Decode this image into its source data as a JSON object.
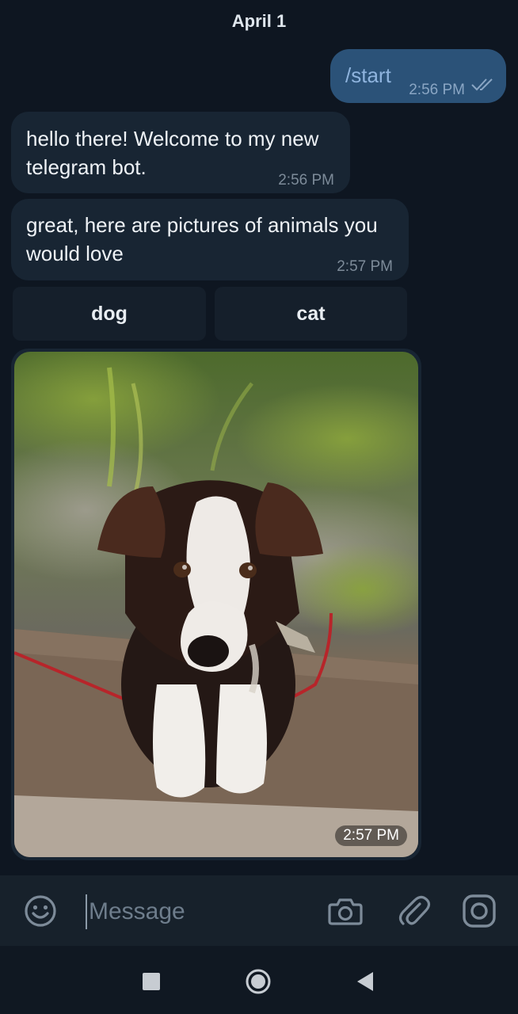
{
  "chat": {
    "date_label": "April 1",
    "messages": [
      {
        "direction": "outgoing",
        "text": "/start",
        "time": "2:56 PM",
        "read": true
      },
      {
        "direction": "incoming",
        "text": "hello there! Welcome to my new telegram bot.",
        "time": "2:56 PM"
      },
      {
        "direction": "incoming",
        "text": "great, here are pictures of animals you would love",
        "time": "2:57 PM"
      }
    ],
    "keyboard": {
      "buttons": [
        "dog",
        "cat"
      ]
    },
    "photo_message": {
      "time": "2:57 PM",
      "subject": "puppy-photo"
    }
  },
  "input_bar": {
    "placeholder": "Message",
    "icons": [
      "emoji-icon",
      "camera-icon",
      "attach-icon",
      "instagram-icon"
    ]
  },
  "nav_bar": {
    "icons": [
      "recents-square-icon",
      "home-circle-icon",
      "back-triangle-icon"
    ]
  },
  "colors": {
    "background": "#0e1621",
    "incoming_bubble": "#182533",
    "outgoing_bubble": "#2b5278",
    "input_bar": "#17212b",
    "nav_bar": "#101822"
  }
}
